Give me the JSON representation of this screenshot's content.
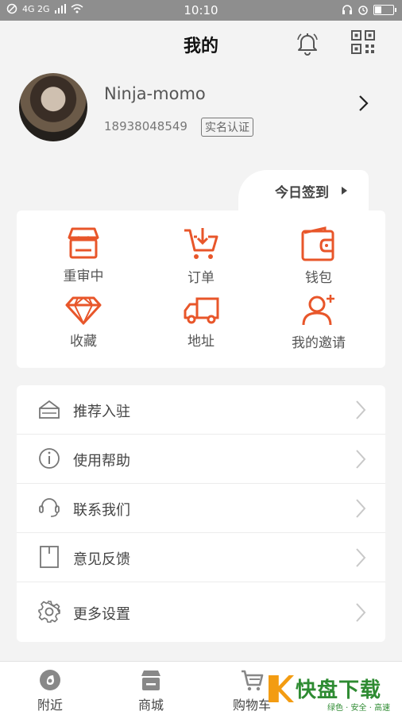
{
  "status_bar": {
    "time": "10:10",
    "network": "4G 2G",
    "icons": [
      "no-disturb-icon",
      "signal-icon",
      "wifi-icon",
      "headset-icon",
      "alarm-icon",
      "battery-icon"
    ]
  },
  "header": {
    "title": "我的",
    "actions": [
      "bell-icon",
      "qrcode-icon"
    ]
  },
  "profile": {
    "username": "Ninja-momo",
    "phone": "18938048549",
    "verify_badge": "实名认证"
  },
  "checkin": {
    "label": "今日签到"
  },
  "grid_items": [
    {
      "label": "重审中",
      "icon": "shop-icon"
    },
    {
      "label": "订单",
      "icon": "cart-download-icon"
    },
    {
      "label": "钱包",
      "icon": "wallet-icon"
    },
    {
      "label": "收藏",
      "icon": "diamond-icon"
    },
    {
      "label": "地址",
      "icon": "truck-icon"
    },
    {
      "label": "我的邀请",
      "icon": "user-add-icon"
    }
  ],
  "menu_items": [
    {
      "label": "推荐入驻",
      "icon": "tray-icon"
    },
    {
      "label": "使用帮助",
      "icon": "info-icon"
    },
    {
      "label": "联系我们",
      "icon": "headset-icon"
    },
    {
      "label": "意见反馈",
      "icon": "feedback-icon"
    },
    {
      "label": "更多设置",
      "icon": "gear-icon"
    }
  ],
  "tabs": [
    {
      "label": "附近",
      "icon": "compass-icon"
    },
    {
      "label": "商城",
      "icon": "store-icon"
    },
    {
      "label": "购物车",
      "icon": "cart-icon"
    }
  ],
  "watermark": {
    "brand": "快盘下载",
    "tagline": "绿色 · 安全 · 高速"
  },
  "colors": {
    "accent": "#e8562a",
    "background": "#f3f3f3",
    "status_bar": "#8e8e8e"
  }
}
